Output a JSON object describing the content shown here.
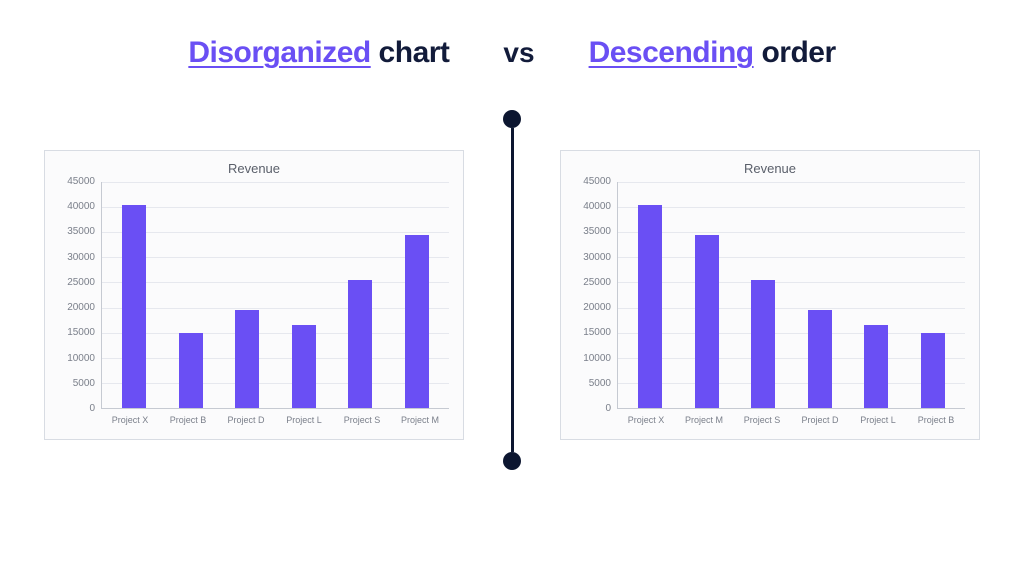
{
  "heading": {
    "left_accent": "Disorganized",
    "left_plain": " chart",
    "vs": "vs",
    "right_accent": "Descending",
    "right_plain": " order"
  },
  "chart_data": [
    {
      "type": "bar",
      "title": "Revenue",
      "categories": [
        "Project X",
        "Project B",
        "Project D",
        "Project L",
        "Project S",
        "Project M"
      ],
      "values": [
        40500,
        15000,
        19500,
        16500,
        25500,
        34500
      ],
      "ylabel": "",
      "xlabel": "",
      "ylim": [
        0,
        45000
      ],
      "yticks": [
        0,
        5000,
        10000,
        15000,
        20000,
        25000,
        30000,
        35000,
        40000,
        45000
      ],
      "bar_color": "#6a4ff4"
    },
    {
      "type": "bar",
      "title": "Revenue",
      "categories": [
        "Project X",
        "Project M",
        "Project S",
        "Project D",
        "Project L",
        "Project B"
      ],
      "values": [
        40500,
        34500,
        25500,
        19500,
        16500,
        15000
      ],
      "ylabel": "",
      "xlabel": "",
      "ylim": [
        0,
        45000
      ],
      "yticks": [
        0,
        5000,
        10000,
        15000,
        20000,
        25000,
        30000,
        35000,
        40000,
        45000
      ],
      "bar_color": "#6a4ff4"
    }
  ]
}
